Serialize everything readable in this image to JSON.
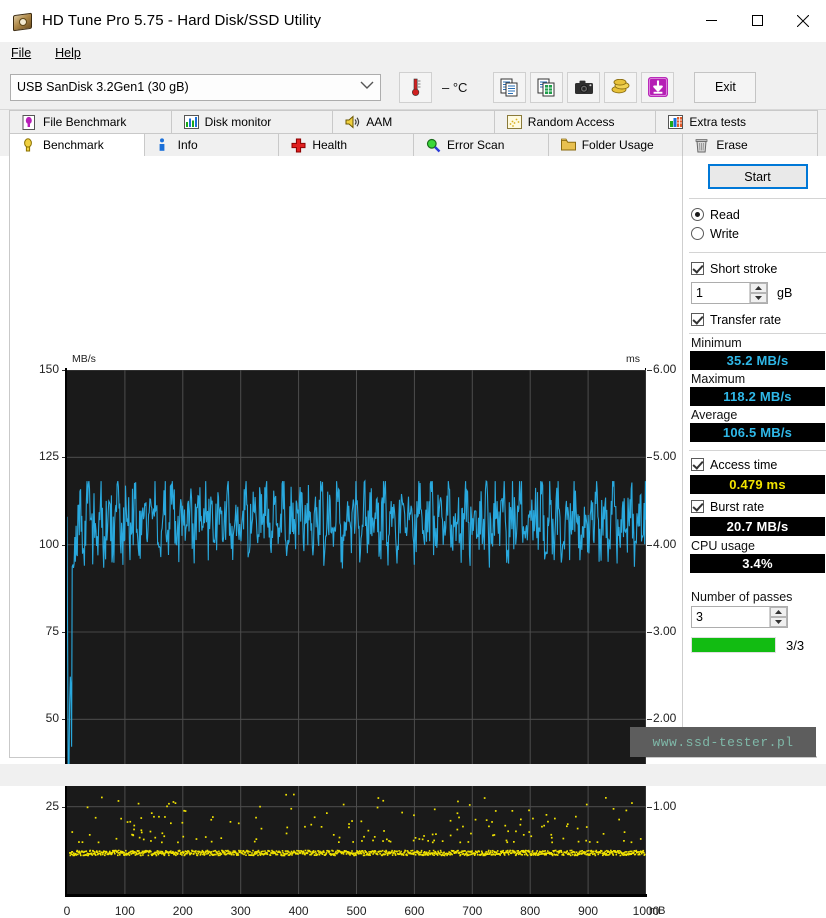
{
  "window": {
    "title": "HD Tune Pro 5.75 - Hard Disk/SSD Utility",
    "icon": "hard-disk-icon",
    "minimize": "—",
    "maximize": "□",
    "close": "✕"
  },
  "menu": [
    {
      "label": "File",
      "mnemonic": "F"
    },
    {
      "label": "Help",
      "mnemonic": "H"
    }
  ],
  "toolbar": {
    "drive": "USB SanDisk 3.2Gen1 (30 gB)",
    "drive_caret": "⌵",
    "temperature": "– °C",
    "temperature_icon": "thermometer-icon",
    "buttons": [
      {
        "name": "copy-icon",
        "tip": "Copy"
      },
      {
        "name": "copy-excel-icon",
        "tip": "Copy to Excel"
      },
      {
        "name": "camera-icon",
        "tip": "Screenshot"
      },
      {
        "name": "coins-icon",
        "tip": "Donate"
      },
      {
        "name": "download-icon",
        "tip": "Download"
      }
    ],
    "exit_label": "Exit"
  },
  "tabs": {
    "row1": [
      {
        "label": "File Benchmark",
        "icon": "file-benchmark-icon",
        "active": false
      },
      {
        "label": "Disk monitor",
        "icon": "disk-monitor-icon",
        "active": false
      },
      {
        "label": "AAM",
        "icon": "speaker-icon",
        "active": false
      },
      {
        "label": "Random Access",
        "icon": "random-access-icon",
        "active": false
      },
      {
        "label": "Extra tests",
        "icon": "extra-tests-icon",
        "active": false
      }
    ],
    "row2": [
      {
        "label": "Benchmark",
        "icon": "benchmark-icon",
        "active": true
      },
      {
        "label": "Info",
        "icon": "info-icon",
        "active": false
      },
      {
        "label": "Health",
        "icon": "health-icon",
        "active": false
      },
      {
        "label": "Error Scan",
        "icon": "error-scan-icon",
        "active": false
      },
      {
        "label": "Folder Usage",
        "icon": "folder-usage-icon",
        "active": false
      },
      {
        "label": "Erase",
        "icon": "erase-icon",
        "active": false
      }
    ]
  },
  "panel": {
    "start_label": "Start",
    "mode_read": "Read",
    "mode_write": "Write",
    "mode_selected": "Read",
    "short_stroke_label": "Short stroke",
    "short_stroke_checked": true,
    "short_stroke_value": "1",
    "short_stroke_unit": "gB",
    "transfer_rate_label": "Transfer rate",
    "transfer_rate_checked": true,
    "minimum_label": "Minimum",
    "minimum_value": "35.2 MB/s",
    "maximum_label": "Maximum",
    "maximum_value": "118.2 MB/s",
    "average_label": "Average",
    "average_value": "106.5 MB/s",
    "access_time_label": "Access time",
    "access_time_checked": true,
    "access_time_value": "0.479 ms",
    "burst_rate_label": "Burst rate",
    "burst_rate_checked": true,
    "burst_rate_value": "20.7 MB/s",
    "cpu_usage_label": "CPU usage",
    "cpu_usage_value": "3.4%",
    "passes_label": "Number of passes",
    "passes_value": "3",
    "progress_text": "3/3",
    "progress_percent": 100,
    "progress_color": "#12bc12"
  },
  "watermark": "www.ssd-tester.pl",
  "chart_data": {
    "type": "line",
    "title": "",
    "xlabel": "mB",
    "ylabel": "MB/s",
    "y2label": "ms",
    "xlim": [
      0,
      1000
    ],
    "ylim": [
      0,
      150
    ],
    "y2lim": [
      0,
      6.0
    ],
    "xticks": [
      0,
      100,
      200,
      300,
      400,
      500,
      600,
      700,
      800,
      900,
      1000
    ],
    "yticks": [
      25,
      50,
      75,
      100,
      125,
      150
    ],
    "y2ticks": [
      1.0,
      2.0,
      3.0,
      4.0,
      5.0,
      6.0
    ],
    "grid": true,
    "legend": "none",
    "series": [
      {
        "name": "Transfer rate",
        "color": "#29a8dd",
        "axis": "left",
        "unit": "MB/s",
        "minimum": 35.2,
        "maximum": 118.2,
        "average": 106.5,
        "description": "Dense oscillating read-speed trace spanning 0-1000 mB, oscillating roughly between 95 and 118 MB/s with an initial drop spike down to 35.2 MB/s at the start.",
        "values": [
          108.0,
          35.2,
          96.5,
          103.0,
          112.0,
          99.0,
          107.5,
          115.0,
          101.0,
          110.0,
          104.0,
          117.0,
          98.0,
          106.0,
          113.0,
          100.0,
          109.0,
          116.0,
          97.5,
          105.5,
          111.0,
          102.0,
          108.5,
          114.0,
          99.5,
          107.0,
          112.5,
          101.5,
          110.5,
          103.5,
          117.5,
          98.5,
          106.5,
          113.5,
          100.5,
          109.5,
          115.5,
          97.0,
          105.0,
          111.5,
          102.5,
          108.0,
          114.5,
          99.0,
          107.5,
          112.0,
          101.0,
          110.0,
          104.0,
          118.0,
          98.0,
          106.0,
          113.0,
          100.0,
          109.0,
          116.0,
          97.5,
          105.5,
          111.0,
          102.0,
          108.5,
          114.0,
          99.5,
          107.0,
          112.5,
          101.5,
          110.5,
          103.5,
          117.0,
          98.5,
          106.5,
          113.5,
          100.5,
          109.5,
          115.5,
          97.0,
          105.0,
          111.5,
          102.5,
          108.0,
          114.5,
          99.0,
          107.5,
          112.0,
          101.0,
          110.0,
          104.0,
          118.2,
          98.0,
          106.0,
          113.0,
          100.0,
          109.0,
          116.0,
          97.5,
          105.5,
          111.0,
          102.0,
          108.5,
          114.0,
          99.5,
          107.0,
          112.5,
          101.5,
          110.5,
          103.5,
          117.0,
          98.5,
          106.5,
          113.5,
          100.5,
          109.5,
          115.5,
          97.0,
          105.0,
          111.5,
          102.5,
          108.0,
          114.5,
          99.0,
          107.5,
          112.0,
          101.0,
          110.0,
          104.0,
          117.5,
          98.0,
          106.0,
          113.0,
          100.0,
          109.0,
          116.0,
          97.5,
          105.5,
          111.0,
          102.0,
          108.5,
          114.0,
          99.5,
          107.0,
          112.5,
          101.5,
          110.5,
          103.5,
          117.0,
          98.5,
          106.5,
          113.5,
          100.5,
          109.5,
          115.5,
          97.0,
          105.0,
          111.5,
          102.5,
          108.0,
          114.5,
          99.0,
          107.5,
          112.0,
          101.0,
          110.0,
          104.0,
          118.0,
          98.0,
          106.0,
          113.0,
          100.0,
          109.0,
          116.0,
          97.5,
          105.5,
          111.0,
          102.0,
          108.5,
          114.0,
          99.5,
          107.0,
          112.5,
          101.5,
          110.5,
          103.5,
          117.0,
          98.5,
          106.5,
          113.5,
          100.5,
          109.5,
          115.5,
          97.0,
          105.0,
          111.5,
          102.5,
          108.0,
          114.5,
          99.0,
          107.5,
          112.0,
          101.0,
          112.0
        ]
      },
      {
        "name": "Access time",
        "color": "#f2e400",
        "axis": "right",
        "unit": "ms",
        "average": 0.479,
        "description": "Yellow scatter of access-time samples forming a dense band at about 0.48 ms with sparse outliers scattered up to roughly 1.1 ms.",
        "band_ms": 0.479,
        "outlier_range_ms": [
          0.6,
          1.15
        ]
      }
    ]
  }
}
